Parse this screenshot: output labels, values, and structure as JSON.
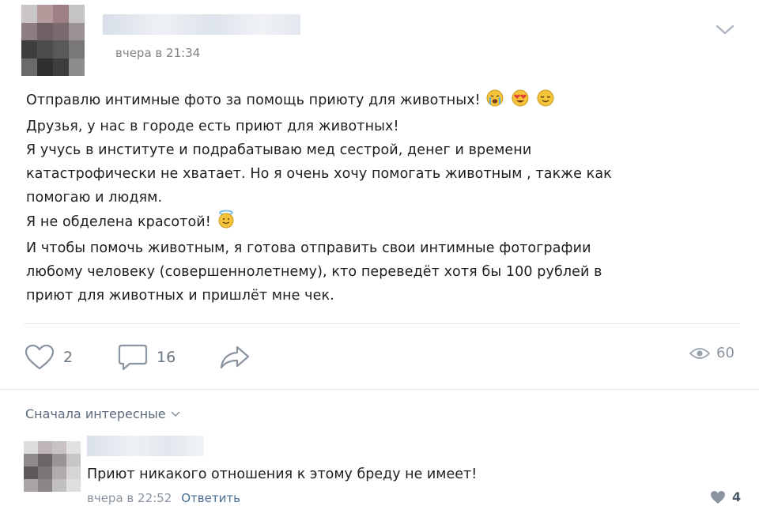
{
  "post": {
    "time": "вчера в 21:34",
    "text_lines": [
      "Отправлю интимные фото за помощь приюту для животных!",
      "Друзья, у нас в городе есть приют для животных!",
      "Я учусь в институте и подрабатываю мед сестрой, денег и времени",
      "катастрофически не хватает. Но я очень хочу помогать животным , также как",
      "помогаю и людям.",
      "Я не обделена красотой!",
      "И чтобы помочь животным, я готова отправить свои интимные фотографии",
      "любому человеку (совершеннолетнему), кто переведёт хотя бы 100 рублей в",
      "приют для животных и пришлёт мне чек."
    ],
    "likes": "2",
    "comments": "16",
    "views": "60",
    "icons": {
      "menu": "chevron-down-icon",
      "like": "heart-icon",
      "comment": "comment-icon",
      "share": "share-arrow-icon",
      "views": "eye-icon",
      "emoji_line1": [
        "crying-face-emoji",
        "heart-eyes-emoji",
        "relieved-face-emoji"
      ],
      "emoji_line6": [
        "halo-face-emoji"
      ]
    }
  },
  "comments_section": {
    "sort_label": "Сначала интересные",
    "comment": {
      "text": "Приют никакого отношения к этому бреду не имеет!",
      "time": "вчера в 22:52",
      "reply_label": "Ответить",
      "likes": "4"
    }
  },
  "colors": {
    "text": "#1e1e1e",
    "meta": "#828282",
    "link": "#4a6e94",
    "icon": "#8a94a0",
    "divider": "#e6e8ec"
  }
}
